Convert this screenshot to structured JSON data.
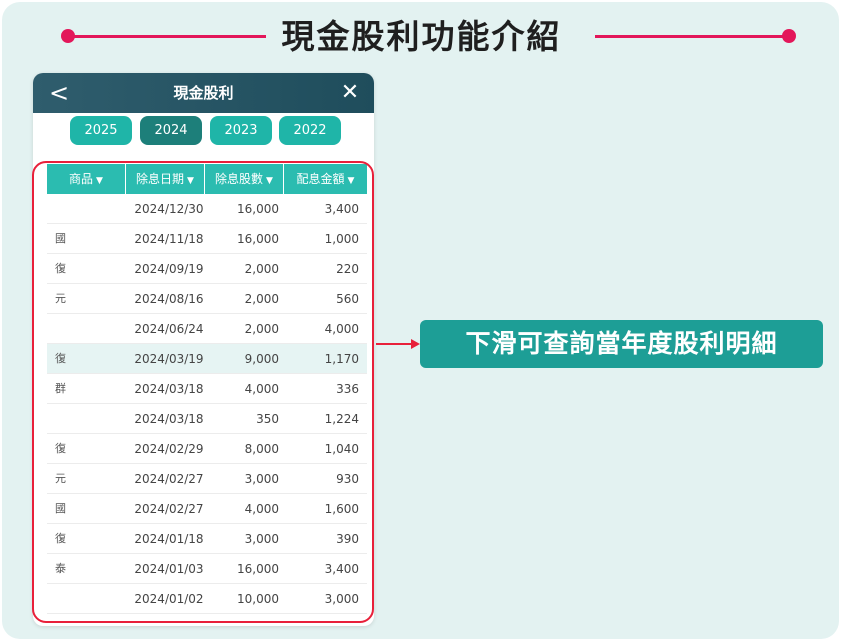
{
  "banner": {
    "title": "現金股利功能介紹",
    "accent_color": "#e3175a"
  },
  "phone": {
    "header_title": "現金股利",
    "back_icon": "chevron-left-icon",
    "back_glyph": "<",
    "close_icon": "close-icon",
    "close_glyph": "✕",
    "year_tabs": [
      {
        "label": "2025",
        "active": false
      },
      {
        "label": "2024",
        "active": true
      },
      {
        "label": "2023",
        "active": false
      },
      {
        "label": "2022",
        "active": false
      }
    ],
    "table": {
      "columns": [
        {
          "label": "商品",
          "sort": "▼"
        },
        {
          "label": "除息日期",
          "sort": "▼"
        },
        {
          "label": "除息股數",
          "sort": "▼"
        },
        {
          "label": "配息金額",
          "sort": "▼"
        }
      ],
      "rows": [
        {
          "product": "",
          "date": "2024/12/30",
          "shares": "16,000",
          "amount": "3,400",
          "highlight": false
        },
        {
          "product": "國",
          "date": "2024/11/18",
          "shares": "16,000",
          "amount": "1,000",
          "highlight": false
        },
        {
          "product": "復",
          "date": "2024/09/19",
          "shares": "2,000",
          "amount": "220",
          "highlight": false
        },
        {
          "product": "元",
          "date": "2024/08/16",
          "shares": "2,000",
          "amount": "560",
          "highlight": false
        },
        {
          "product": "",
          "date": "2024/06/24",
          "shares": "2,000",
          "amount": "4,000",
          "highlight": false
        },
        {
          "product": "復",
          "date": "2024/03/19",
          "shares": "9,000",
          "amount": "1,170",
          "highlight": true
        },
        {
          "product": "群",
          "date": "2024/03/18",
          "shares": "4,000",
          "amount": "336",
          "highlight": false
        },
        {
          "product": "",
          "date": "2024/03/18",
          "shares": "350",
          "amount": "1,224",
          "highlight": false
        },
        {
          "product": "復",
          "date": "2024/02/29",
          "shares": "8,000",
          "amount": "1,040",
          "highlight": false
        },
        {
          "product": "元",
          "date": "2024/02/27",
          "shares": "3,000",
          "amount": "930",
          "highlight": false
        },
        {
          "product": "國",
          "date": "2024/02/27",
          "shares": "4,000",
          "amount": "1,600",
          "highlight": false
        },
        {
          "product": "復",
          "date": "2024/01/18",
          "shares": "3,000",
          "amount": "390",
          "highlight": false
        },
        {
          "product": "泰",
          "date": "2024/01/03",
          "shares": "16,000",
          "amount": "3,400",
          "highlight": false
        },
        {
          "product": "",
          "date": "2024/01/02",
          "shares": "10,000",
          "amount": "3,000",
          "highlight": false
        }
      ]
    }
  },
  "callout": {
    "text": "下滑可查詢當年度股利明細",
    "color": "#1d9e96"
  }
}
